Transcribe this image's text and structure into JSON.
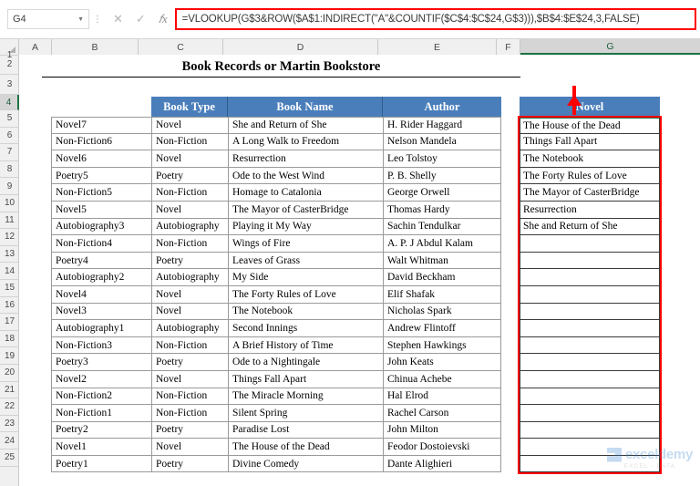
{
  "app": {
    "name_box_value": "G4",
    "formula": "=VLOOKUP(G$3&ROW($A$1:INDIRECT(\"A\"&COUNTIF($C$4:$C$24,G$3))),$B$4:$E$24,3,FALSE)",
    "cancel_icon": "close-icon",
    "confirm_icon": "check-icon",
    "function_icon": "fx-icon",
    "dropdown_icon": "chevron-down-icon"
  },
  "columns": [
    "A",
    "B",
    "C",
    "D",
    "E",
    "F",
    "G"
  ],
  "selected_column": "G",
  "rows": [
    1,
    2,
    3,
    4,
    5,
    6,
    7,
    8,
    9,
    10,
    11,
    12,
    13,
    14,
    15,
    16,
    17,
    18,
    19,
    20,
    21,
    22,
    23,
    24,
    25
  ],
  "selected_row": 4,
  "sheet": {
    "title": "Book Records or Martin Bookstore",
    "table_headers": [
      "Book Type",
      "Book Name",
      "Author"
    ],
    "records": [
      {
        "key": "Novel7",
        "type": "Novel",
        "name": "She and Return of She",
        "author": "H. Rider Haggard"
      },
      {
        "key": "Non-Fiction6",
        "type": "Non-Fiction",
        "name": "A Long Walk to Freedom",
        "author": "Nelson Mandela"
      },
      {
        "key": "Novel6",
        "type": "Novel",
        "name": "Resurrection",
        "author": "Leo Tolstoy"
      },
      {
        "key": "Poetry5",
        "type": "Poetry",
        "name": "Ode to the West Wind",
        "author": "P. B. Shelly"
      },
      {
        "key": "Non-Fiction5",
        "type": "Non-Fiction",
        "name": "Homage to Catalonia",
        "author": "George Orwell"
      },
      {
        "key": "Novel5",
        "type": "Novel",
        "name": "The Mayor of CasterBridge",
        "author": "Thomas Hardy"
      },
      {
        "key": "Autobiography3",
        "type": "Autobiography",
        "name": "Playing it My Way",
        "author": "Sachin Tendulkar"
      },
      {
        "key": "Non-Fiction4",
        "type": "Non-Fiction",
        "name": "Wings of Fire",
        "author": "A. P. J Abdul Kalam"
      },
      {
        "key": "Poetry4",
        "type": "Poetry",
        "name": "Leaves of Grass",
        "author": "Walt Whitman"
      },
      {
        "key": "Autobiography2",
        "type": "Autobiography",
        "name": "My Side",
        "author": "David Beckham"
      },
      {
        "key": "Novel4",
        "type": "Novel",
        "name": "The Forty Rules of Love",
        "author": "Elif Shafak"
      },
      {
        "key": "Novel3",
        "type": "Novel",
        "name": "The Notebook",
        "author": "Nicholas Spark"
      },
      {
        "key": "Autobiography1",
        "type": "Autobiography",
        "name": "Second Innings",
        "author": "Andrew Flintoff"
      },
      {
        "key": "Non-Fiction3",
        "type": "Non-Fiction",
        "name": "A Brief History of Time",
        "author": "Stephen Hawkings"
      },
      {
        "key": "Poetry3",
        "type": "Poetry",
        "name": "Ode to a Nightingale",
        "author": "John Keats"
      },
      {
        "key": "Novel2",
        "type": "Novel",
        "name": "Things Fall Apart",
        "author": "Chinua Achebe"
      },
      {
        "key": "Non-Fiction2",
        "type": "Non-Fiction",
        "name": "The Miracle Morning",
        "author": "Hal Elrod"
      },
      {
        "key": "Non-Fiction1",
        "type": "Non-Fiction",
        "name": "Silent Spring",
        "author": "Rachel Carson"
      },
      {
        "key": "Poetry2",
        "type": "Poetry",
        "name": "Paradise Lost",
        "author": "John Milton"
      },
      {
        "key": "Novel1",
        "type": "Novel",
        "name": "The House of the Dead",
        "author": "Feodor Dostoievski"
      },
      {
        "key": "Poetry1",
        "type": "Poetry",
        "name": "Divine Comedy",
        "author": "Dante Alighieri"
      }
    ],
    "result_column": {
      "header": "Novel",
      "values": [
        "The House of the Dead",
        "Things Fall Apart",
        "The Notebook",
        "The Forty Rules of Love",
        "The Mayor of CasterBridge",
        "Resurrection",
        "She and Return of She",
        "",
        "",
        "",
        "",
        "",
        "",
        "",
        "",
        "",
        "",
        "",
        "",
        "",
        ""
      ]
    }
  },
  "annotation": {
    "highlight_color": "#ff0000",
    "header_fill": "#4a7ebb"
  },
  "watermark": {
    "text": "exceldemy",
    "subtext": "EXCEL - DATA"
  }
}
